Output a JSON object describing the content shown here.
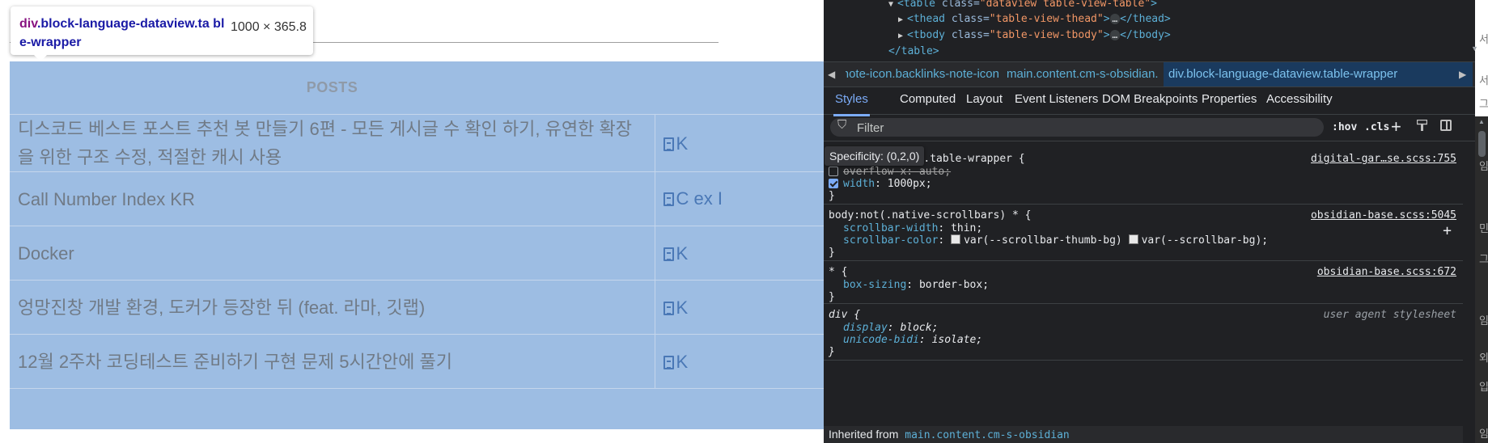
{
  "tooltip": {
    "tag": "div",
    "classes": ".block-language-dataview.ta ble-wrapper",
    "size": "1000 × 365.8"
  },
  "table": {
    "header": "POSTS",
    "rows": [
      {
        "title": "디스코드 베스트 포스트 추천 봇 만들기 6편 - 모든 게시글 수 확인 하기, 유연한 확장을 위한 구조 수정, 적절한 캐시 사용",
        "link": "K"
      },
      {
        "title": "Call Number Index KR",
        "link": "C ex I"
      },
      {
        "title": "Docker",
        "link": "K"
      },
      {
        "title": "엉망진창 개발 환경, 도커가 등장한 뒤 (feat. 라마, 깃랩)",
        "link": "K"
      },
      {
        "title": "12월 2주차 코딩테스트 준비하기 구현 문제 5시간안에 풀기",
        "link": "K"
      }
    ]
  },
  "devtools": {
    "elements": {
      "line1": {
        "tag_open": "<table",
        "attr": "class",
        "value": "\"dataview table-view-table\"",
        "tag_close": ">"
      },
      "line2": {
        "tag_open": "<thead",
        "attr": "class",
        "value": "\"table-view-thead\"",
        "tag_close": ">",
        "dots": "…",
        "end": "</thead>"
      },
      "line3": {
        "tag_open": "<tbody",
        "attr": "class",
        "value": "\"table-view-tbody\"",
        "tag_close": ">",
        "dots": "…",
        "end": "</tbody>"
      },
      "line4": "</table>"
    },
    "breadcrumb": {
      "item1": "nks-note-icon.backlinks-note-icon",
      "item2": "main.content.cm-s-obsidian.",
      "item3": "div.block-language-dataview.table-wrapper"
    },
    "tabs": [
      "Styles",
      "Computed",
      "Layout",
      "Event Listeners",
      "DOM Breakpoints",
      "Properties",
      "Accessibility"
    ],
    "filter": {
      "placeholder": "Filter",
      "hov": ":hov",
      "cls": ".cls"
    },
    "specificity": "Specificity: (0,2,0)",
    "rules": {
      "r1": {
        "selector": ".cm-s-obsidian .table-wrapper {",
        "source": "digital-gar…se.scss:755",
        "decl1_prop": "overflow-x",
        "decl1_val": "auto;",
        "decl2_prop": "width",
        "decl2_val": "1000px;"
      },
      "r2": {
        "selector": "body:not(.native-scrollbars) * {",
        "source": "obsidian-base.scss:5045",
        "decl1_prop": "scrollbar-width",
        "decl1_val": "thin;",
        "decl2_prop": "scrollbar-color",
        "decl2_val_a": "var(--scrollbar-thumb-bg)",
        "decl2_val_b": "var(--scrollbar-bg);"
      },
      "r3": {
        "selector": "* {",
        "source": "obsidian-base.scss:672",
        "decl1_prop": "box-sizing",
        "decl1_val": "border-box;"
      },
      "r4": {
        "selector": "div {",
        "source": "user agent stylesheet",
        "decl1_prop": "display",
        "decl1_val": "block;",
        "decl2_prop": "unicode-bidi",
        "decl2_val": "isolate;"
      },
      "close": "}"
    },
    "inherited": {
      "label": "Inherited from",
      "link": "main.content.cm-s-obsidian"
    }
  },
  "edge_glyphs": [
    "서",
    "서",
    "그",
    "임",
    "민",
    "그",
    "임",
    "외",
    "입",
    "임"
  ],
  "colors": {
    "highlight": "#9dbde3",
    "devtools_bg": "#202124",
    "accent": "#7cacf8",
    "tag": "#5db0d7",
    "attr_value": "#f29766"
  }
}
